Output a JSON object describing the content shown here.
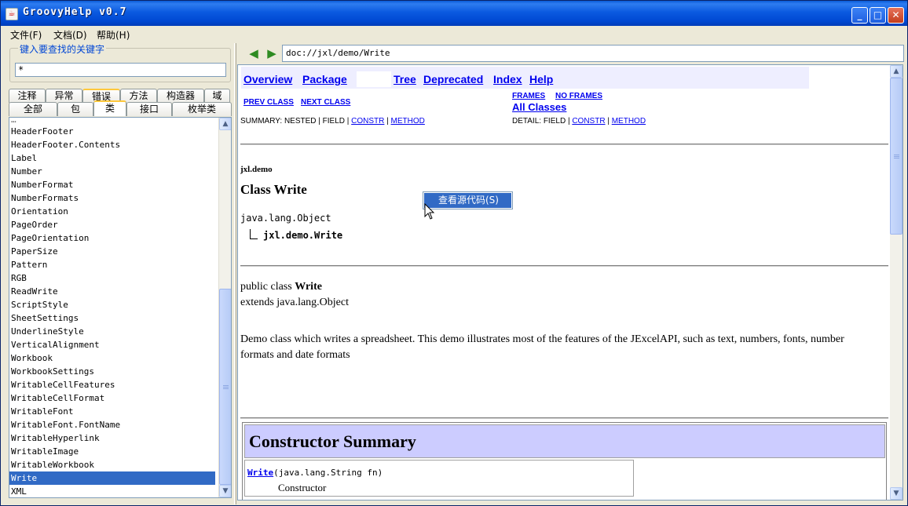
{
  "window": {
    "title": "GroovyHelp v0.7",
    "icon": "java-icon"
  },
  "menu": [
    "文件(F)",
    "文档(D)",
    "帮助(H)"
  ],
  "search": {
    "label": "键入要查找的关键字",
    "value": "*"
  },
  "tabs_row1": [
    "注释",
    "异常",
    "错误",
    "方法",
    "构造器",
    "域"
  ],
  "tabs_row2": [
    "全部",
    "包",
    "类",
    "接口",
    "枚举类"
  ],
  "class_list": [
    "HeaderFooter",
    "HeaderFooter.Contents",
    "Label",
    "Number",
    "NumberFormat",
    "NumberFormats",
    "Orientation",
    "PageOrder",
    "PageOrientation",
    "PaperSize",
    "Pattern",
    "RGB",
    "ReadWrite",
    "ScriptStyle",
    "SheetSettings",
    "UnderlineStyle",
    "VerticalAlignment",
    "Workbook",
    "WorkbookSettings",
    "WritableCellFeatures",
    "WritableCellFormat",
    "WritableFont",
    "WritableFont.FontName",
    "WritableHyperlink",
    "WritableImage",
    "WritableWorkbook",
    "Write",
    "XML"
  ],
  "selected_class": "Write",
  "address": "doc://jxl/demo/Write",
  "doc": {
    "nav": {
      "overview": "Overview",
      "package": "Package",
      "tree": "Tree",
      "deprecated": "Deprecated",
      "index": "Index",
      "help": "Help"
    },
    "prev_class": "PREV CLASS",
    "next_class": "NEXT CLASS",
    "frames": "FRAMES",
    "no_frames": "NO FRAMES",
    "all_classes": "All Classes",
    "summary_prefix": "SUMMARY: NESTED | FIELD | ",
    "detail_prefix": "DETAIL: FIELD | ",
    "constr": "CONSTR",
    "method": "METHOD",
    "sep": " | ",
    "package_name": "jxl.demo",
    "class_title": "Class Write",
    "super_class": "java.lang.Object",
    "this_class": "jxl.demo.Write",
    "decl_prefix": "public class ",
    "decl_name": "Write",
    "extends_line": "extends java.lang.Object",
    "description": "Demo class which writes a spreadsheet. This demo illustrates most of the features of the JExcelAPI, such as text, numbers, fonts, number formats and date formats",
    "constructor_summary_title": "Constructor Summary",
    "constructor_name": "Write",
    "constructor_params": "(java.lang.String  fn)",
    "constructor_desc": "Constructor"
  },
  "context_menu": {
    "item": "查看源代码(S)"
  }
}
